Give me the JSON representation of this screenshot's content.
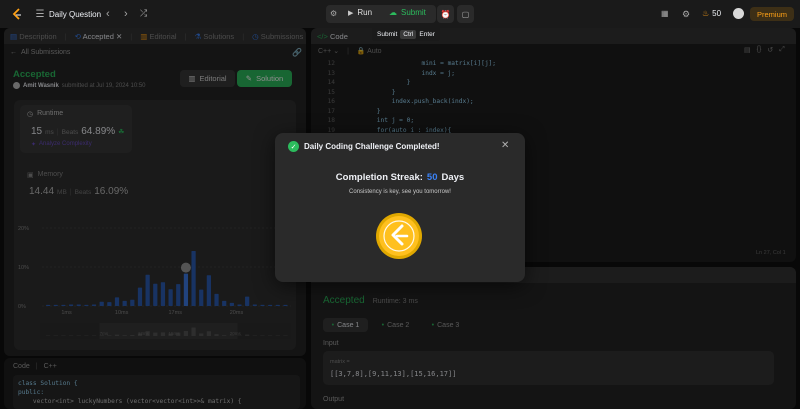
{
  "topbar": {
    "title": "Daily Question",
    "run_label": "Run",
    "submit_label": "Submit",
    "coins": "50",
    "premium_label": "Premium",
    "tooltip": {
      "label": "Submit",
      "key1": "Ctrl",
      "key2": "Enter"
    }
  },
  "left_tabs": [
    {
      "label": "Description",
      "icon": "document-icon"
    },
    {
      "label": "Accepted",
      "icon": "history-icon"
    },
    {
      "label": "Editorial",
      "icon": "book-icon"
    },
    {
      "label": "Solutions",
      "icon": "flask-icon"
    },
    {
      "label": "Submissions",
      "icon": "clock-icon"
    }
  ],
  "submission": {
    "back_label": "All Submissions",
    "status": "Accepted",
    "author": "Amit Wasnik",
    "submitted_at": "submitted at Jul 19, 2024 10:50",
    "editorial_label": "Editorial",
    "solution_label": "Solution",
    "runtime_label": "Runtime",
    "runtime_value": "15",
    "runtime_unit": "ms",
    "beats_label": "Beats",
    "runtime_beats": "64.89%",
    "analyze_label": "Analyze Complexity",
    "memory_label": "Memory",
    "memory_value": "14.44",
    "memory_unit": "MB",
    "memory_beats": "16.09%"
  },
  "chart_data": {
    "type": "bar",
    "ytick_labels": [
      "20%",
      "10%",
      "0%"
    ],
    "xtick_labels": [
      "1ms",
      "10ms",
      "17ms",
      "20ms"
    ],
    "mini_tick_labels": [
      "7ms",
      "12ms",
      "15ms",
      "20ms"
    ],
    "ylim": [
      0,
      20
    ],
    "values": [
      0.3,
      0.3,
      0.3,
      0.4,
      0.4,
      0.3,
      0.4,
      1.1,
      1.0,
      2.2,
      1.3,
      1.6,
      4.7,
      8.0,
      5.7,
      6.1,
      4.3,
      5.6,
      8.3,
      14.1,
      4.2,
      7.9,
      3.1,
      1.3,
      0.8,
      0.4,
      2.4,
      0.4,
      0.3,
      0.3,
      0.3,
      0.3
    ],
    "highlight_index": 18,
    "bar_color": "#2c5eb5",
    "highlight_color": "#3d7ae6"
  },
  "code_preview": {
    "label": "Code",
    "lang": "C++",
    "lines": [
      "class Solution {",
      "public:",
      "    vector<int> luckyNumbers (vector<vector<int>>& matrix) {"
    ]
  },
  "editor": {
    "tab_label": "Code",
    "lang": "C++",
    "auto_label": "Auto",
    "status": "Ln 27, Col 1",
    "lines": [
      {
        "n": "12",
        "t": "                    mini = matrix[i][j];"
      },
      {
        "n": "13",
        "t": "                    indx = j;"
      },
      {
        "n": "14",
        "t": "                }"
      },
      {
        "n": "15",
        "t": "            }"
      },
      {
        "n": "16",
        "t": "            index.push_back(indx);"
      },
      {
        "n": "17",
        "t": "        }"
      },
      {
        "n": "18",
        "t": "        int j = 0;"
      },
      {
        "n": "19",
        "t": "        for(auto i : index){"
      }
    ]
  },
  "result": {
    "status": "Accepted",
    "runtime": "Runtime: 3 ms",
    "cases": [
      "Case 1",
      "Case 2",
      "Case 3"
    ],
    "input_label": "Input",
    "var_name": "matrix =",
    "var_value": "[[3,7,8],[9,11,13],[15,16,17]]",
    "output_label": "Output"
  },
  "modal": {
    "title": "Daily Coding Challenge Completed!",
    "streak_label": "Completion Streak:",
    "streak_value": "50",
    "streak_unit": "Days",
    "subtitle": "Consistency is key, see you tomorrow!"
  },
  "colors": {
    "accent_green": "#2cbb5d",
    "gold": "#ffc01e",
    "orange": "#ffa116"
  }
}
